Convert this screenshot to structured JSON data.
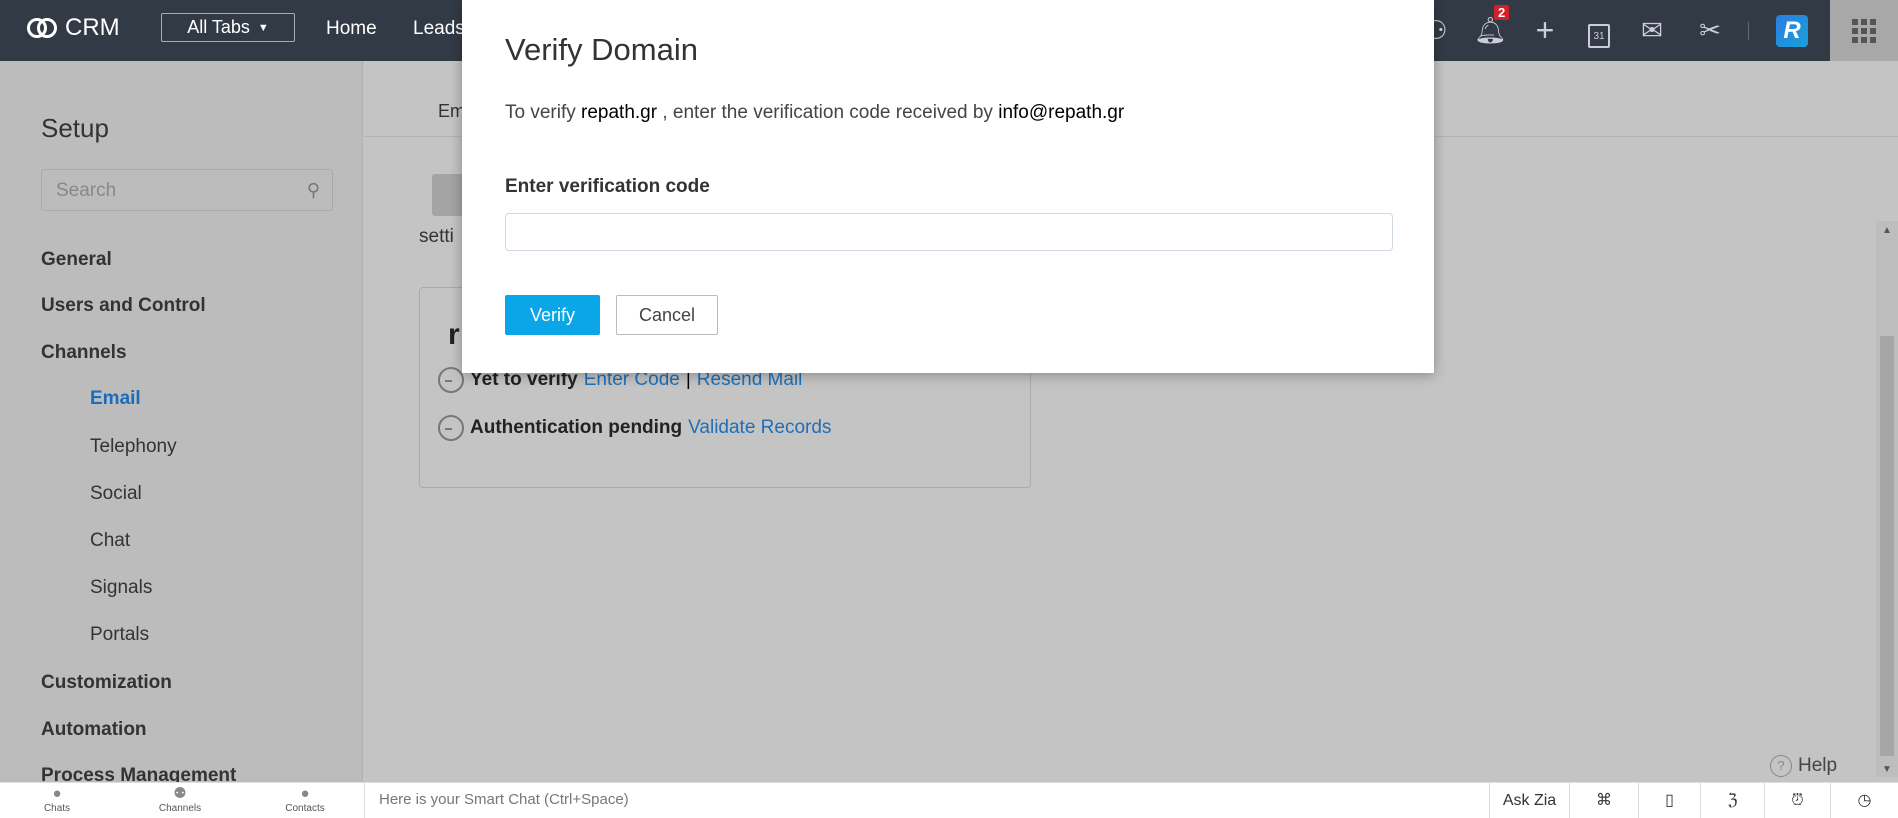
{
  "topbar": {
    "logo": "CRM",
    "all_tabs": "All Tabs",
    "nav": [
      "Home",
      "Leads"
    ],
    "notification_count": "2",
    "calendar_day": "31",
    "profile_initial": "R"
  },
  "sidebar": {
    "title": "Setup",
    "search_placeholder": "Search",
    "items": [
      {
        "label": "General"
      },
      {
        "label": "Users and Control"
      },
      {
        "label": "Channels"
      },
      {
        "label": "Email"
      },
      {
        "label": "Telephony"
      },
      {
        "label": "Social"
      },
      {
        "label": "Chat"
      },
      {
        "label": "Signals"
      },
      {
        "label": "Portals"
      },
      {
        "label": "Customization"
      },
      {
        "label": "Automation"
      },
      {
        "label": "Process Management"
      }
    ]
  },
  "main": {
    "tab": "Em",
    "settings_text": "setti",
    "card": {
      "title": "r",
      "row1": {
        "status": "Yet to verify",
        "link1": "Enter Code",
        "separator": "|",
        "link2": "Resend Mail"
      },
      "row2": {
        "status": "Authentication pending",
        "link": "Validate Records"
      }
    },
    "help": "Help"
  },
  "bottombar": {
    "chats": "Chats",
    "channels": "Channels",
    "contacts": "Contacts",
    "smart_chat_placeholder": "Here is your Smart Chat (Ctrl+Space)",
    "ask_zia": "Ask Zia"
  },
  "modal": {
    "title": "Verify Domain",
    "text_prefix": "To verify ",
    "domain": "repath.gr",
    "text_middle": " , enter the verification code received by ",
    "email": "info@repath.gr",
    "label": "Enter verification code",
    "input_value": "",
    "verify": "Verify",
    "cancel": "Cancel"
  },
  "colors": {
    "accent": "#0aa6e8",
    "topbar": "#323a46",
    "link": "#1f6fb8",
    "badge": "#d0202a"
  }
}
